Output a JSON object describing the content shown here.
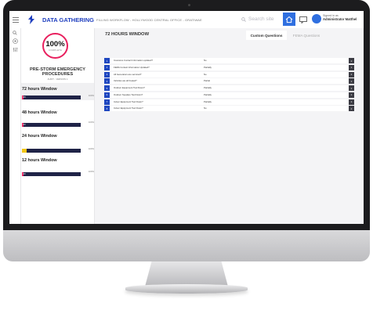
{
  "app": {
    "title": "DATA GATHERING",
    "subtitle": "FILLING WORKFLOW - HOLLYWOOD CENTRAL OFFICE - GRATIWAE",
    "accent_color": "#1f3fbf",
    "brand_color": "#2f6fe0"
  },
  "search": {
    "placeholder": "Search site"
  },
  "user": {
    "line1": "Signed in as",
    "name": "Administrator Matthel"
  },
  "icons": [
    "menu-icon",
    "logo-icon",
    "search-icon",
    "home-icon",
    "messages-icon",
    "avatar-icon",
    "rail-search-icon",
    "rail-plus-icon",
    "rail-filter-icon"
  ],
  "panel": {
    "progress_percent": "100%",
    "progress_label": "COMPLETE",
    "ring_color": "#e8205e",
    "title_line1": "PRE-STORM EMERGENCY",
    "title_line2": "PROCEDURES",
    "version": "AUDIT - VERSION 1",
    "windows": [
      {
        "name": "72 hours Window",
        "percent": "100%",
        "fill_color": "#e8205e",
        "bar_label": "5/5",
        "fill_fraction": 0.03
      },
      {
        "name": "48 hours Window",
        "percent": "100%",
        "fill_color": "#e8205e",
        "bar_label": "0/0",
        "fill_fraction": 0.03
      },
      {
        "name": "24 hours Window",
        "percent": "100%",
        "fill_color": "#f2c617",
        "bar_label": "",
        "fill_fraction": 0.08
      },
      {
        "name": "12 hours Window",
        "percent": "100%",
        "fill_color": "#e8205e",
        "bar_label": "0/0",
        "fill_fraction": 0.03
      }
    ]
  },
  "main": {
    "title": "72 HOURS WINDOW",
    "tabs": [
      "Custom Questions",
      "FEMA Questions"
    ],
    "questions": [
      {
        "num": "1",
        "question": "Insurance Contact Information updated?",
        "answer": "No",
        "count": "2"
      },
      {
        "num": "2",
        "question": "FEMA Contact Information Updated?",
        "answer": "Partially",
        "count": "1"
      },
      {
        "num": "3",
        "question": "All Generators are serviced?",
        "answer": "No",
        "count": "2"
      },
      {
        "num": "4",
        "question": "Vehicles are all Fueled?",
        "answer": "Partial",
        "count": "1"
      },
      {
        "num": "5",
        "question": "Outdoor Equipment Tied Down?",
        "answer": "Partially",
        "count": "1"
      },
      {
        "num": "6",
        "question": "Outdoor Supplies Tied Down?",
        "answer": "Partially",
        "count": "1"
      },
      {
        "num": "7",
        "question": "Indoor Equipment Tied Down?",
        "answer": "Partially",
        "count": "1"
      },
      {
        "num": "8",
        "question": "Indoor Equipment Tied Down?",
        "answer": "No",
        "count": "2"
      }
    ]
  }
}
